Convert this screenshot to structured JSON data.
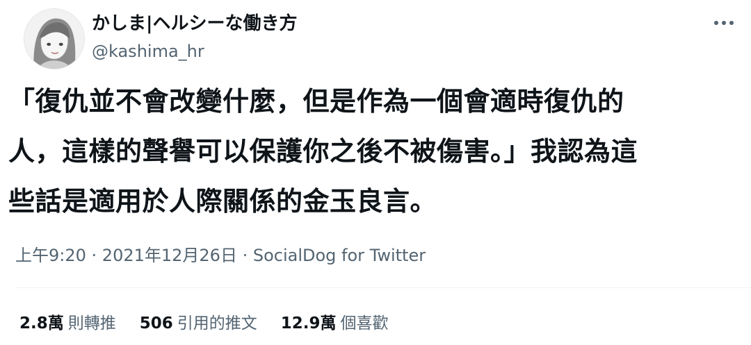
{
  "user": {
    "display_name": "かしま|ヘルシーな働き方",
    "handle": "@kashima_hr"
  },
  "tweet": {
    "lines": [
      "「復仇並不會改變什麼，但是作為一個會適時復仇的",
      "人，這樣的聲譽可以保護你之後不被傷害。」我認為這",
      "些話是適用於人際關係的金玉良言。"
    ],
    "time": "上午9:20",
    "separator": " · ",
    "date": "2021年12月26日",
    "source": "SocialDog for Twitter"
  },
  "stats": {
    "retweets": {
      "count": "2.8萬",
      "label": "則轉推"
    },
    "quotes": {
      "count": "506",
      "label": "引用的推文"
    },
    "likes": {
      "count": "12.9萬",
      "label": "個喜歡"
    }
  },
  "icons": {
    "more": "more-dots-icon",
    "avatar": "avatar-illustration"
  }
}
